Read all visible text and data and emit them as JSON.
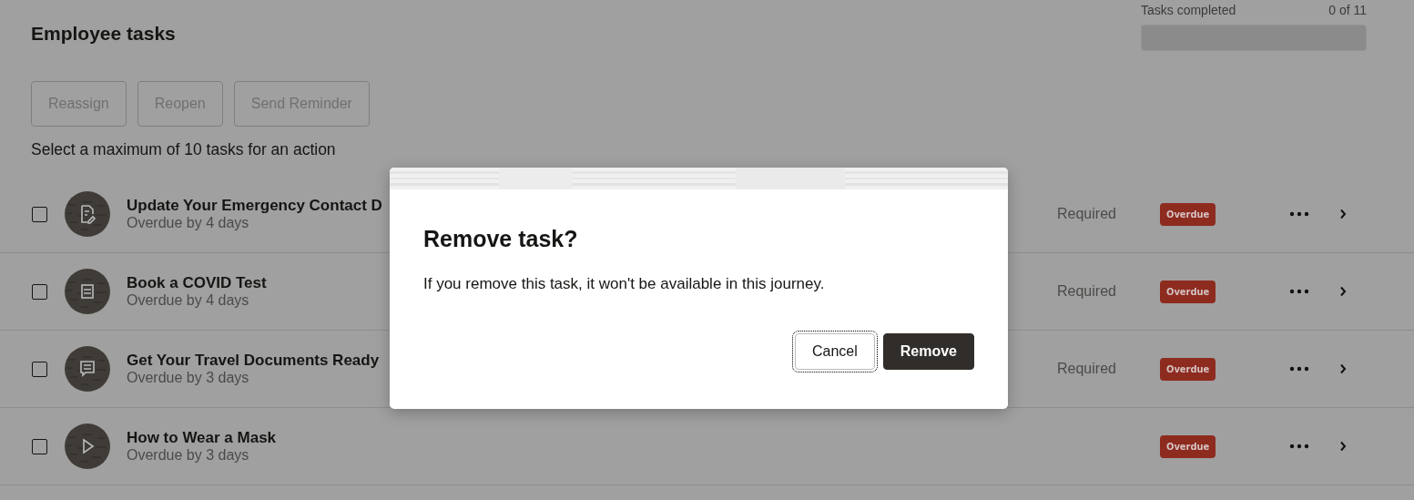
{
  "page": {
    "title": "Employee tasks",
    "progress": {
      "label": "Tasks completed",
      "count": "0 of 11",
      "level": 0
    },
    "actions": [
      {
        "label": "Reassign",
        "disabled": true
      },
      {
        "label": "Reopen",
        "disabled": true
      },
      {
        "label": "Send Reminder",
        "disabled": true
      }
    ],
    "hint": "Select a maximum of 10 tasks for an action",
    "tasks": [
      {
        "title": "Update Your Emergency Contact D",
        "subtitle": "Overdue by 4 days",
        "requirement": "Required",
        "status": "Overdue",
        "checked": false,
        "kind": "form"
      },
      {
        "title": "Book a COVID Test",
        "subtitle": "Overdue by 4 days",
        "requirement": "Required",
        "status": "Overdue",
        "checked": false,
        "kind": "document"
      },
      {
        "title": "Get Your Travel Documents Ready",
        "subtitle": "Overdue by 3 days",
        "requirement": "Required",
        "status": "Overdue",
        "checked": false,
        "kind": "message"
      },
      {
        "title": "How to Wear a Mask",
        "subtitle": "Overdue by 3 days",
        "status": "Overdue",
        "checked": false,
        "kind": "video"
      }
    ]
  },
  "dialog": {
    "title": "Remove task?",
    "message": "If you remove this task, it won't be available in this journey.",
    "buttons": [
      {
        "label": "Cancel",
        "kind": "secondary",
        "focused": true
      },
      {
        "label": "Remove",
        "kind": "primary",
        "focused": false
      }
    ]
  }
}
